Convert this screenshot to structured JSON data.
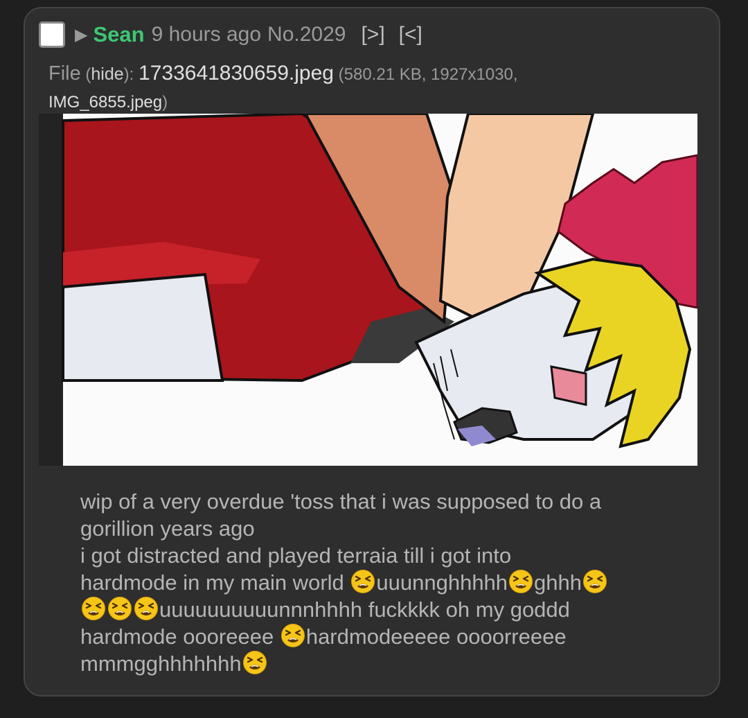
{
  "post": {
    "arrow": "▶",
    "name": "Sean",
    "time": "9 hours ago",
    "number": "No.2029",
    "links": [
      "[>]",
      "[<]"
    ]
  },
  "file": {
    "label": "File",
    "hide_open": "(",
    "hide_label": "hide",
    "hide_close": "):",
    "filename": "1733641830659.jpeg",
    "details": "(580.21 KB, 1927x1030,",
    "original_name": "IMG_6855.jpeg",
    "details_close": ")"
  },
  "image": {
    "alt": "cartoon drawing of a character in a red shirt with yellow hair lying face down while being pinned by a pair of legs"
  },
  "comment": {
    "line1": "wip of a very overdue 'toss that i was supposed to do a",
    "line2": "gorillion years ago",
    "line3": "i got distracted and played terraia till i got into",
    "line4_a": "hardmode in my main world ",
    "line4_b": "uuunnghhhhh",
    "line4_c": "ghhh",
    "line5": "uuuuuuuuuunnnhhhh fuckkkk oh my goddd",
    "line6_a": "hardmode oooreeee ",
    "line6_b": "hardmodeeeee oooorreeee",
    "line7": "mmmgghhhhhhh",
    "emoji_name": "tired-face-emoji"
  },
  "colors": {
    "name": "#3ec773",
    "background": "#1f1f1f",
    "panel": "#2e2e2e",
    "text": "#b5b5b5",
    "muted": "#9a9a9a",
    "emoji": "#f5c518"
  }
}
